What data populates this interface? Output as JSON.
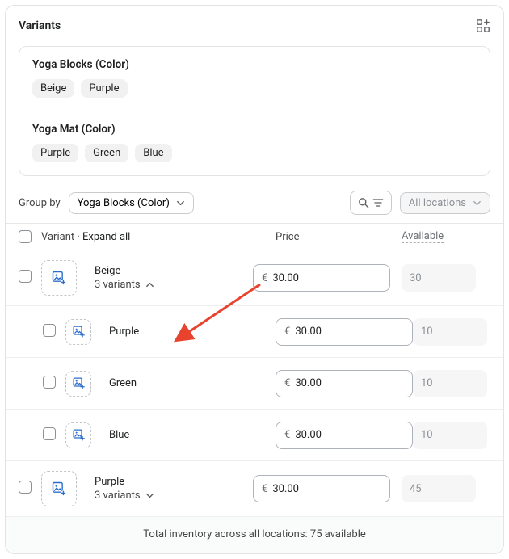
{
  "header": {
    "title": "Variants"
  },
  "options": [
    {
      "title": "Yoga Blocks (Color)",
      "values": [
        "Beige",
        "Purple"
      ]
    },
    {
      "title": "Yoga Mat (Color)",
      "values": [
        "Purple",
        "Green",
        "Blue"
      ]
    }
  ],
  "toolbar": {
    "group_by_label": "Group by",
    "group_by_value": "Yoga Blocks (Color)",
    "locations_label": "All locations"
  },
  "columns": {
    "variant": "Variant",
    "expand_all": "Expand all",
    "price": "Price",
    "available": "Available"
  },
  "currency": "€",
  "rows": [
    {
      "type": "group",
      "name": "Beige",
      "sublabel": "3 variants",
      "expanded": true,
      "price": "30.00",
      "available": "30"
    },
    {
      "type": "child",
      "name": "Purple",
      "price": "30.00",
      "available": "10"
    },
    {
      "type": "child",
      "name": "Green",
      "price": "30.00",
      "available": "10"
    },
    {
      "type": "child",
      "name": "Blue",
      "price": "30.00",
      "available": "10"
    },
    {
      "type": "group",
      "name": "Purple",
      "sublabel": "3 variants",
      "expanded": false,
      "price": "30.00",
      "available": "45"
    }
  ],
  "footer": {
    "text": "Total inventory across all locations: 75 available"
  },
  "annotation": {
    "arrow_color": "#e8432f"
  }
}
